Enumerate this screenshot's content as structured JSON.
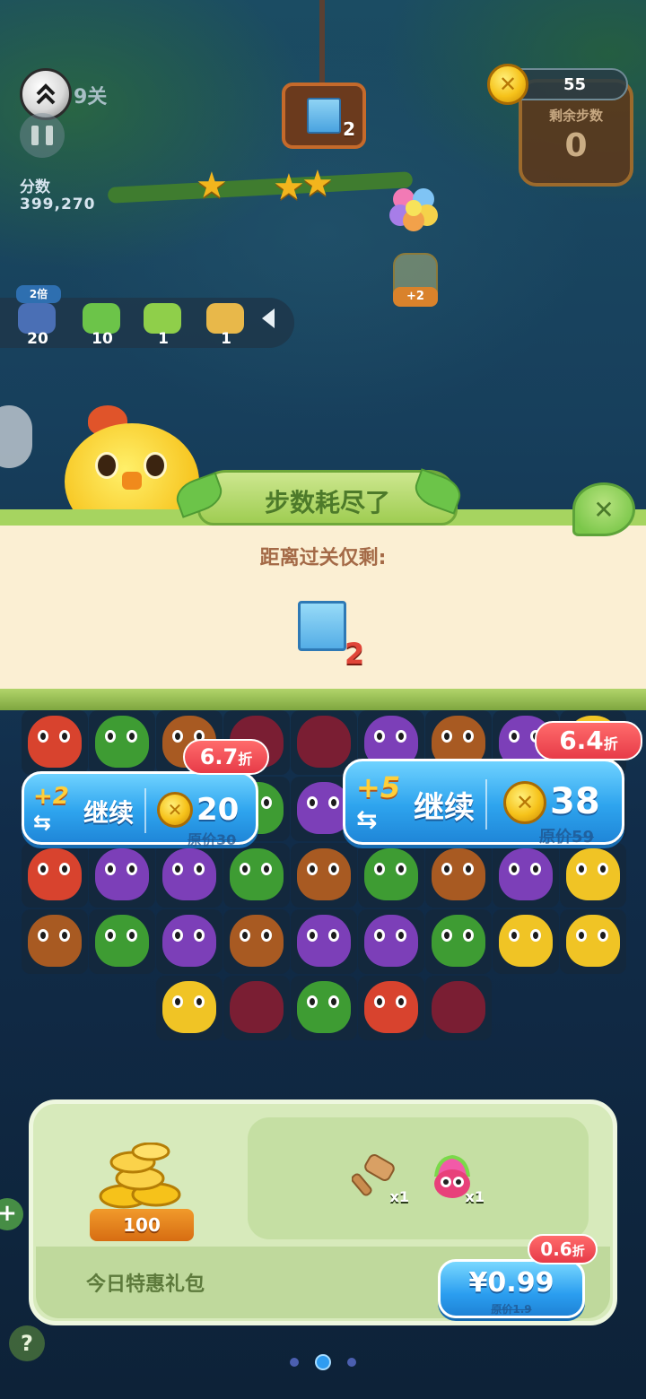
{
  "hud": {
    "level_label": "9关",
    "score_label": "分数",
    "score_value": "399,270",
    "goal_count": "2",
    "coins": "55",
    "moves_label": "剩余步数",
    "moves_value": "0",
    "cage_bonus": "+2"
  },
  "boosters": {
    "double_badge": "2倍",
    "items": [
      {
        "icon": "glove-booster-icon",
        "count": "20",
        "color": "#4a6fb5"
      },
      {
        "icon": "heart-booster-icon",
        "count": "10",
        "color": "#6cc449"
      },
      {
        "icon": "leaf-booster-icon",
        "count": "1",
        "color": "#8fcf4a"
      },
      {
        "icon": "ticket-booster-icon",
        "count": "1",
        "color": "#e8b84a"
      }
    ]
  },
  "dialog": {
    "title": "步数耗尽了",
    "subtitle": "距离过关仅剩:",
    "remaining_count": "2"
  },
  "continue_options": [
    {
      "moves": "+2",
      "label": "继续",
      "price": "20",
      "original": "原价30",
      "discount": "6.7",
      "discount_unit": "折"
    },
    {
      "moves": "+5",
      "label": "继续",
      "price": "38",
      "original": "原价59",
      "discount": "6.4",
      "discount_unit": "折"
    }
  ],
  "gift_pack": {
    "name": "今日特惠礼包",
    "coin_amount": "100",
    "items": [
      {
        "icon": "hammer-icon",
        "qty": "x1"
      },
      {
        "icon": "rainbow-owl-icon",
        "qty": "x1"
      }
    ],
    "price": "¥0.99",
    "original": "原价1.9",
    "discount": "0.6",
    "discount_unit": "折"
  },
  "pager": {
    "pages": 3,
    "active": 1
  }
}
